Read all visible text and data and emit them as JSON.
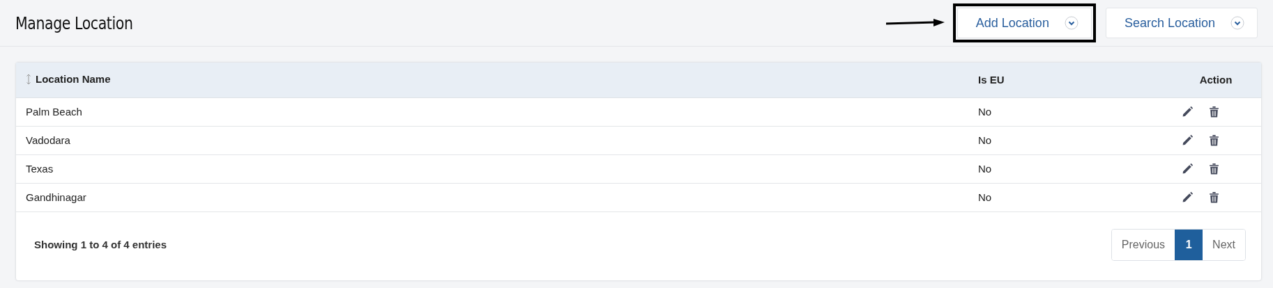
{
  "page_title": "Manage Location",
  "header_buttons": [
    {
      "label": "Add Location",
      "highlighted": true
    },
    {
      "label": "Search Location",
      "highlighted": false
    }
  ],
  "table": {
    "columns": [
      {
        "label": "Location Name",
        "sortable": true
      },
      {
        "label": "Is EU",
        "sortable": false
      },
      {
        "label": "Action",
        "sortable": false
      }
    ],
    "rows": [
      {
        "location_name": "Palm Beach",
        "is_eu": "No"
      },
      {
        "location_name": "Vadodara",
        "is_eu": "No"
      },
      {
        "location_name": "Texas",
        "is_eu": "No"
      },
      {
        "location_name": "Gandhinagar",
        "is_eu": "No"
      }
    ]
  },
  "summary": "Showing 1 to 4 of 4 entries",
  "pagination": [
    {
      "label": "Previous",
      "selected": false
    },
    {
      "label": "1",
      "selected": true
    },
    {
      "label": "Next",
      "selected": false
    }
  ]
}
